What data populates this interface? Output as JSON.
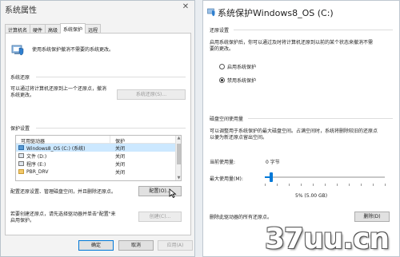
{
  "left_window": {
    "title": "系统属性",
    "tabs": [
      "计算机名",
      "硬件",
      "高级",
      "系统保护",
      "远程"
    ],
    "active_tab_index": 3,
    "intro_text": "使用系统保护撤消不需要的系统更改。",
    "restore": {
      "section_label": "系统还原",
      "text_line1": "可以通过将计算机还原到上一个还原点，撤消",
      "text_line2": "系统更改。",
      "button": "系统还原(S)..."
    },
    "protection": {
      "section_label": "保护设置",
      "col_drive": "可用驱动器",
      "col_protection": "保护",
      "drives": [
        {
          "name": "Windows8_OS (C:) (系统)",
          "protection": "关闭",
          "icon": "windows-drive-icon",
          "selected": true
        },
        {
          "name": "文件 (D:)",
          "protection": "关闭",
          "icon": "drive-icon",
          "selected": false
        },
        {
          "name": "程序 (E:)",
          "protection": "关闭",
          "icon": "drive-icon",
          "selected": false
        },
        {
          "name": "PBR_DRV",
          "protection": "关闭",
          "icon": "folder-icon",
          "selected": false
        }
      ],
      "configure_text": "配置还原设置、管理磁盘空间，并且删除还原点。",
      "configure_button": "配置(O)...",
      "create_text_line1": "若要创建还原点，请先选择驱动器并单击\"配置\"来",
      "create_text_line2": "启用保护。",
      "create_button": "创建(C)..."
    },
    "footer": {
      "ok": "确定",
      "cancel": "取消",
      "apply": "应用(A)"
    }
  },
  "right_dialog": {
    "title": "系统保护Windows8_OS (C:)",
    "restore_settings": {
      "section_label": "还原设置",
      "text_line1": "启用系统保护后，你可以通过及时将计算机还原到以前的某个状态来撤消不需",
      "text_line2": "要的更改。",
      "option_on": "启用系统保护",
      "option_off": "禁用系统保护",
      "selected": "off"
    },
    "disk_usage": {
      "section_label": "磁盘空间使用量",
      "text_line1": "可以调整用于系统保护的最大磁盘空间。占满空间时，系统将删除较旧的还原点",
      "text_line2": "以便为新还原点留出空间。",
      "current_label": "当前使用量:",
      "current_value": "0 字节",
      "max_label": "最大使用量(M):",
      "slider_fraction": 0.05,
      "slider_value_text": "5% (5.00 GB)",
      "delete_text": "删除此驱动器的所有还原点。",
      "delete_button": "删除(D)"
    }
  },
  "watermark": "37uu.cn"
}
